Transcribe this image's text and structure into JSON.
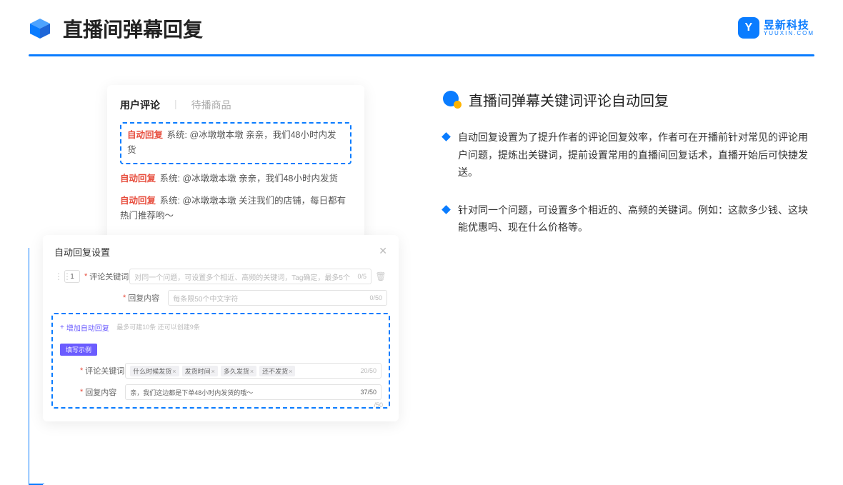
{
  "header": {
    "title": "直播间弹幕回复",
    "logo_text": "昱新科技",
    "logo_sub": "YUUXIN.COM",
    "logo_mark": "Y"
  },
  "comments": {
    "tab_active": "用户评论",
    "tab_inactive": "待播商品",
    "list": [
      {
        "tag": "自动回复",
        "text": "系统: @冰墩墩本墩 亲亲，我们48小时内发货"
      },
      {
        "tag": "自动回复",
        "text": "系统: @冰墩墩本墩 亲亲，我们48小时内发货"
      },
      {
        "tag": "自动回复",
        "text": "系统: @冰墩墩本墩 关注我们的店铺，每日都有热门推荐哟～"
      }
    ]
  },
  "settings": {
    "title": "自动回复设置",
    "close": "✕",
    "idx": "1",
    "keyword_label": "评论关键词",
    "keyword_placeholder": "对同一个问题，可设置多个相近、高频的关键词，Tag确定，最多5个",
    "keyword_count": "0/5",
    "content_label": "回复内容",
    "content_placeholder": "每条限50个中文字符",
    "content_count": "0/50",
    "add_text": "增加自动回复",
    "add_hint": "最多可建10条 还可以创建9条",
    "example_badge": "填写示例",
    "ex_keyword_label": "评论关键词",
    "ex_tags": [
      "什么时候发货",
      "发货时间",
      "多久发货",
      "还不发货"
    ],
    "ex_tag_count": "20/50",
    "ex_content_label": "回复内容",
    "ex_content_text": "亲，我们这边都是下单48小时内发货的哦～",
    "ex_content_count": "37/50",
    "outer_count": "/50"
  },
  "right": {
    "section_title": "直播间弹幕关键词评论自动回复",
    "bullets": [
      "自动回复设置为了提升作者的评论回复效率，作者可在开播前针对常见的评论用户问题，提炼出关键词，提前设置常用的直播间回复话术，直播开始后可快捷发送。",
      "针对同一个问题，可设置多个相近的、高频的关键词。例如：这款多少钱、这块能优惠吗、现在什么价格等。"
    ]
  }
}
